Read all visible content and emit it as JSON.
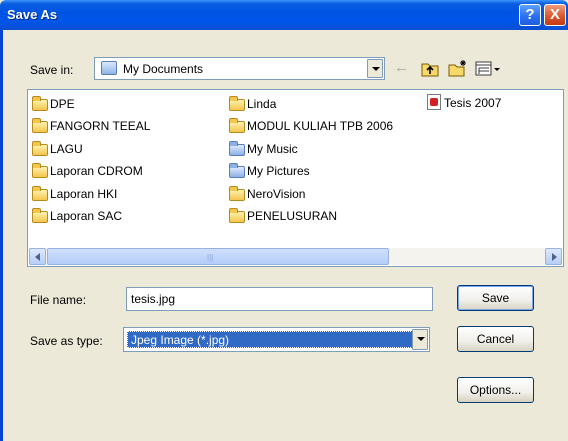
{
  "window": {
    "title": "Save As",
    "help_label": "?",
    "close_label": "X"
  },
  "save_in": {
    "label": "Save in:",
    "value": "My Documents",
    "icon": "my-documents-icon"
  },
  "toolbar": {
    "back_icon": "←",
    "up_icon": "up-folder-icon",
    "new_folder_icon": "new-folder-icon",
    "views_icon": "views-menu-icon"
  },
  "files": [
    {
      "name": "DPE",
      "type": "folder"
    },
    {
      "name": "FANGORN TEEAL",
      "type": "folder"
    },
    {
      "name": "LAGU",
      "type": "folder"
    },
    {
      "name": "Laporan CDROM",
      "type": "folder"
    },
    {
      "name": "Laporan HKI",
      "type": "folder"
    },
    {
      "name": "Laporan SAC",
      "type": "folder"
    },
    {
      "name": "Linda",
      "type": "folder"
    },
    {
      "name": "MODUL KULIAH TPB 2006",
      "type": "folder"
    },
    {
      "name": "My Music",
      "type": "special-folder"
    },
    {
      "name": "My Pictures",
      "type": "special-folder"
    },
    {
      "name": "NeroVision",
      "type": "folder"
    },
    {
      "name": "PENELUSURAN",
      "type": "folder"
    },
    {
      "name": "Tesis 2007",
      "type": "pdf"
    }
  ],
  "file_name": {
    "label": "File name:",
    "value": "tesis.jpg"
  },
  "save_as_type": {
    "label": "Save as type:",
    "value": "Jpeg Image (*.jpg)"
  },
  "buttons": {
    "save": "Save",
    "cancel": "Cancel",
    "options": "Options..."
  },
  "colors": {
    "titlebar": "#0054e3",
    "dialog_bg": "#ece9d8",
    "selection": "#316ac5"
  }
}
